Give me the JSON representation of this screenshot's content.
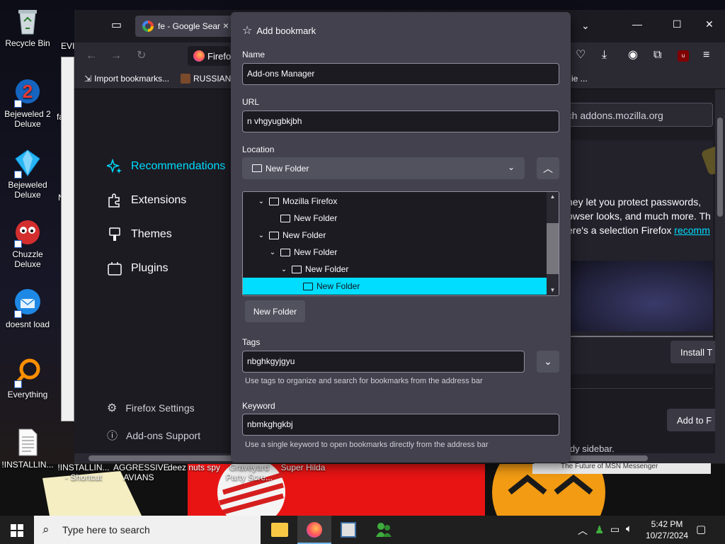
{
  "desktop": {
    "icons": [
      {
        "label": "Recycle Bin"
      },
      {
        "label": "Bejeweled 2 Deluxe"
      },
      {
        "label": "Bejeweled Deluxe"
      },
      {
        "label": "Chuzzle Deluxe"
      },
      {
        "label": "doesnt load"
      },
      {
        "label": "Everything"
      },
      {
        "label": "!INSTALLIN..."
      }
    ],
    "partial_labels": [
      "EVIL",
      "fa",
      "N"
    ],
    "bottom_labels": [
      "!INSTALLIN... - Shortcut",
      "AGGRESSIVE AVIANS",
      "deez nuts spy",
      "Graveyard Party Scre...",
      "Super Hilda"
    ],
    "window_caption": "The Future of MSN Messenger"
  },
  "browser": {
    "tab_title": "fe - Google Sear",
    "tab_close": "×",
    "url_partial": "Firefo",
    "bookmarks_bar": [
      {
        "label": "Import bookmarks..."
      },
      {
        "label": "RUSSIAN"
      }
    ],
    "bookmarks_overflow": "ie ...",
    "window_controls": {
      "minimize": "—",
      "maximize": "☐",
      "close": "✕"
    },
    "search_placeholder": "rch addons.mozilla.org",
    "categories": [
      {
        "label": "Recommendations",
        "selected": true
      },
      {
        "label": "Extensions"
      },
      {
        "label": "Themes"
      },
      {
        "label": "Plugins"
      }
    ],
    "footer_links": [
      {
        "label": "Firefox Settings"
      },
      {
        "label": "Add-ons Support"
      }
    ],
    "content_lines": [
      "hey let you protect passwords,",
      "owser looks, and much more. Th",
      "ere's a selection Firefox "
    ],
    "content_link": "recomm",
    "install_button": "Install T",
    "add_button": "Add to F",
    "sidebar_text": "idy sidebar.",
    "accent": "#00ddff"
  },
  "dialog": {
    "title": "Add bookmark",
    "name_label": "Name",
    "name_value": "Add-ons Manager",
    "url_label": "URL",
    "url_value": "n vhgyugbkjbh",
    "location_label": "Location",
    "location_value": "New Folder",
    "tree": [
      {
        "label": "Mozilla Firefox",
        "depth": 1,
        "expanded": true
      },
      {
        "label": "New Folder",
        "depth": 2
      },
      {
        "label": "New Folder",
        "depth": 1,
        "expanded": true
      },
      {
        "label": "New Folder",
        "depth": 2,
        "expanded": true
      },
      {
        "label": "New Folder",
        "depth": 3,
        "expanded": true
      },
      {
        "label": "New Folder",
        "depth": 4,
        "selected": true
      }
    ],
    "new_folder_button": "New Folder",
    "tags_label": "Tags",
    "tags_value": "nbghkgyjgyu",
    "tags_hint": "Use tags to organize and search for bookmarks from the address bar",
    "keyword_label": "Keyword",
    "keyword_value": "nbmkghgkbj",
    "keyword_hint": "Use a single keyword to open bookmarks directly from the address bar"
  },
  "taskbar": {
    "search_placeholder": "Type here to search",
    "time": "5:42 PM",
    "date": "10/27/2024"
  }
}
